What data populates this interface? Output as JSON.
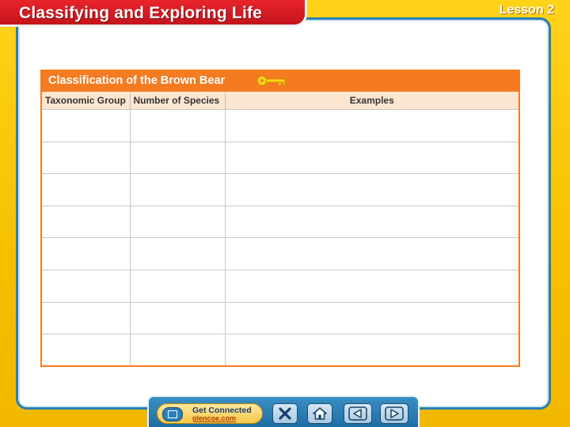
{
  "header": {
    "title": "Classifying and Exploring Life",
    "lesson": "Lesson 2"
  },
  "table": {
    "title": "Classification of the Brown Bear",
    "columns": [
      "Taxonomic Group",
      "Number of Species",
      "Examples"
    ],
    "rows": [
      [
        "",
        "",
        ""
      ],
      [
        "",
        "",
        ""
      ],
      [
        "",
        "",
        ""
      ],
      [
        "",
        "",
        ""
      ],
      [
        "",
        "",
        ""
      ],
      [
        "",
        "",
        ""
      ],
      [
        "",
        "",
        ""
      ],
      [
        "",
        "",
        ""
      ]
    ]
  },
  "nav": {
    "get_connected_label": "Get Connected",
    "get_connected_url": "glencoe.com",
    "buttons": [
      "close-icon",
      "home-icon",
      "back-arrow-icon",
      "forward-arrow-icon"
    ]
  },
  "colors": {
    "background": "#f5c400",
    "title_bar": "#d81c22",
    "panel_border": "#2a7fb3",
    "table_accent": "#f47b20",
    "header_row": "#fde6cf"
  }
}
